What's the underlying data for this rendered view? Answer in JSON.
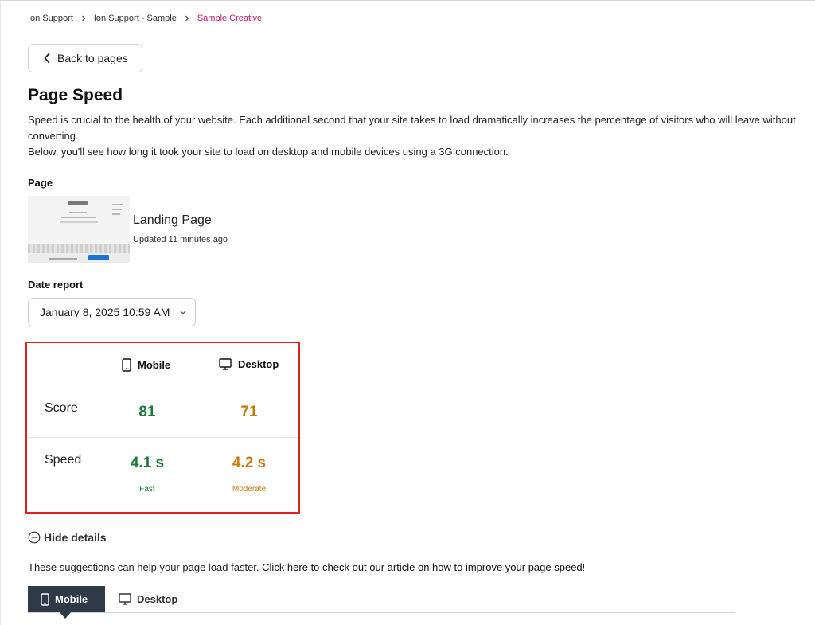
{
  "breadcrumb": {
    "items": [
      "Ion Support",
      "Ion Support - Sample",
      "Sample Creative"
    ]
  },
  "back_button": {
    "label": "Back to pages",
    "icon": "chevron-left-icon"
  },
  "title": "Page Speed",
  "description": "Speed is crucial to the health of your website. Each additional second that your site takes to load dramatically increases the percentage of visitors who will leave without converting.",
  "description2": "Below, you'll see how long it took your site to load on desktop and mobile devices using a 3G connection.",
  "page_section": {
    "label": "Page",
    "page_name": "Landing Page",
    "updated": "Updated 11 minutes ago"
  },
  "date_report": {
    "label": "Date report",
    "selected": "January 8, 2025 10:59 AM"
  },
  "speed_table": {
    "columns": [
      "Mobile",
      "Desktop"
    ],
    "rows": {
      "score_label": "Score",
      "speed_label": "Speed"
    },
    "mobile": {
      "score": "81",
      "speed": "4.1 s",
      "rating": "Fast"
    },
    "desktop": {
      "score": "71",
      "speed": "4.2 s",
      "rating": "Moderate"
    }
  },
  "colors": {
    "good": "#1a7a34",
    "moderate": "#c77a0c",
    "highlight_border": "#e3201c",
    "breadcrumb_current": "#c2185b",
    "active_tab": "#2f3a48"
  },
  "details": {
    "toggle_label": "Hide details",
    "suggestion_text": "These suggestions can help your page load faster.",
    "article_link": "Click here to check out our article on how to improve your page speed!"
  },
  "tabs": [
    {
      "label": "Mobile",
      "icon": "mobile-icon",
      "active": true
    },
    {
      "label": "Desktop",
      "icon": "desktop-icon",
      "active": false
    }
  ]
}
